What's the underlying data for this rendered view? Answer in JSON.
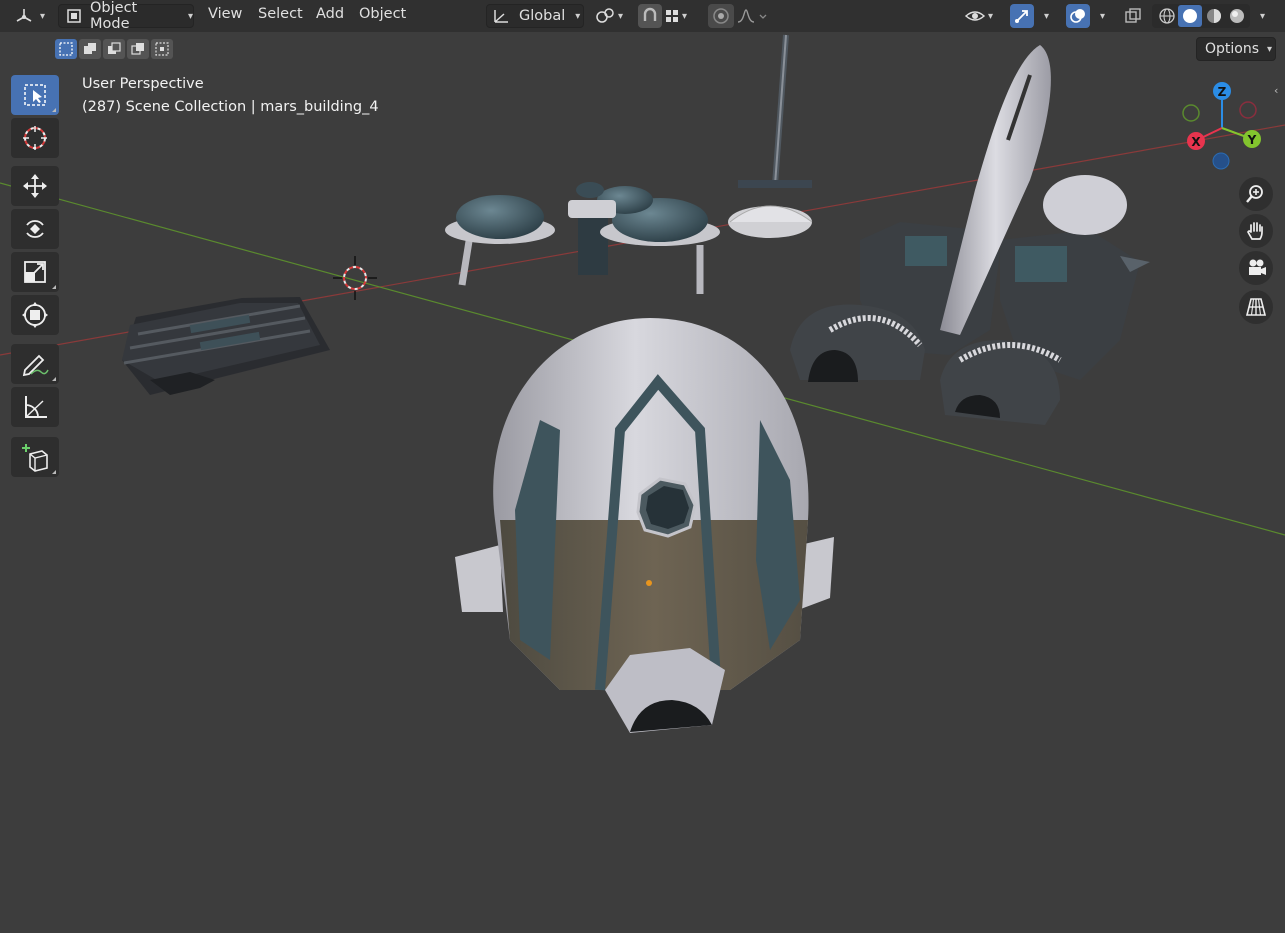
{
  "header": {
    "editor_type_icon": "viewport-3d-icon",
    "mode_label": "Object Mode",
    "menus": [
      "View",
      "Select",
      "Add",
      "Object"
    ],
    "transform_orientation": "Global",
    "icons": [
      "snap-icon",
      "grid-snap-icon",
      "proportional-edit-icon",
      "falloff-icon",
      "visibility-icon",
      "gizmo-icon",
      "overlay-icon",
      "xray-icon",
      "wireframe-shading-icon",
      "solid-shading-icon",
      "material-shading-icon",
      "rendered-shading-icon"
    ]
  },
  "tool_header": {
    "options_label": "Options"
  },
  "viewport": {
    "view_name": "User Perspective",
    "collection_info": "(287) Scene Collection | mars_building_4"
  },
  "gizmo": {
    "z_label": "Z",
    "x_label": "X",
    "y_label": "Y",
    "colors": {
      "x": "#e8344e",
      "y": "#83c52e",
      "z": "#2b8de6"
    }
  },
  "toolbar": {
    "tools": [
      "select-box",
      "cursor",
      "move",
      "rotate",
      "scale",
      "transform",
      "annotate",
      "measure",
      "add-cube"
    ]
  },
  "colors": {
    "active": "#4772b3",
    "viewport_bg": "#3d3d3d",
    "header_bg": "#303030"
  }
}
